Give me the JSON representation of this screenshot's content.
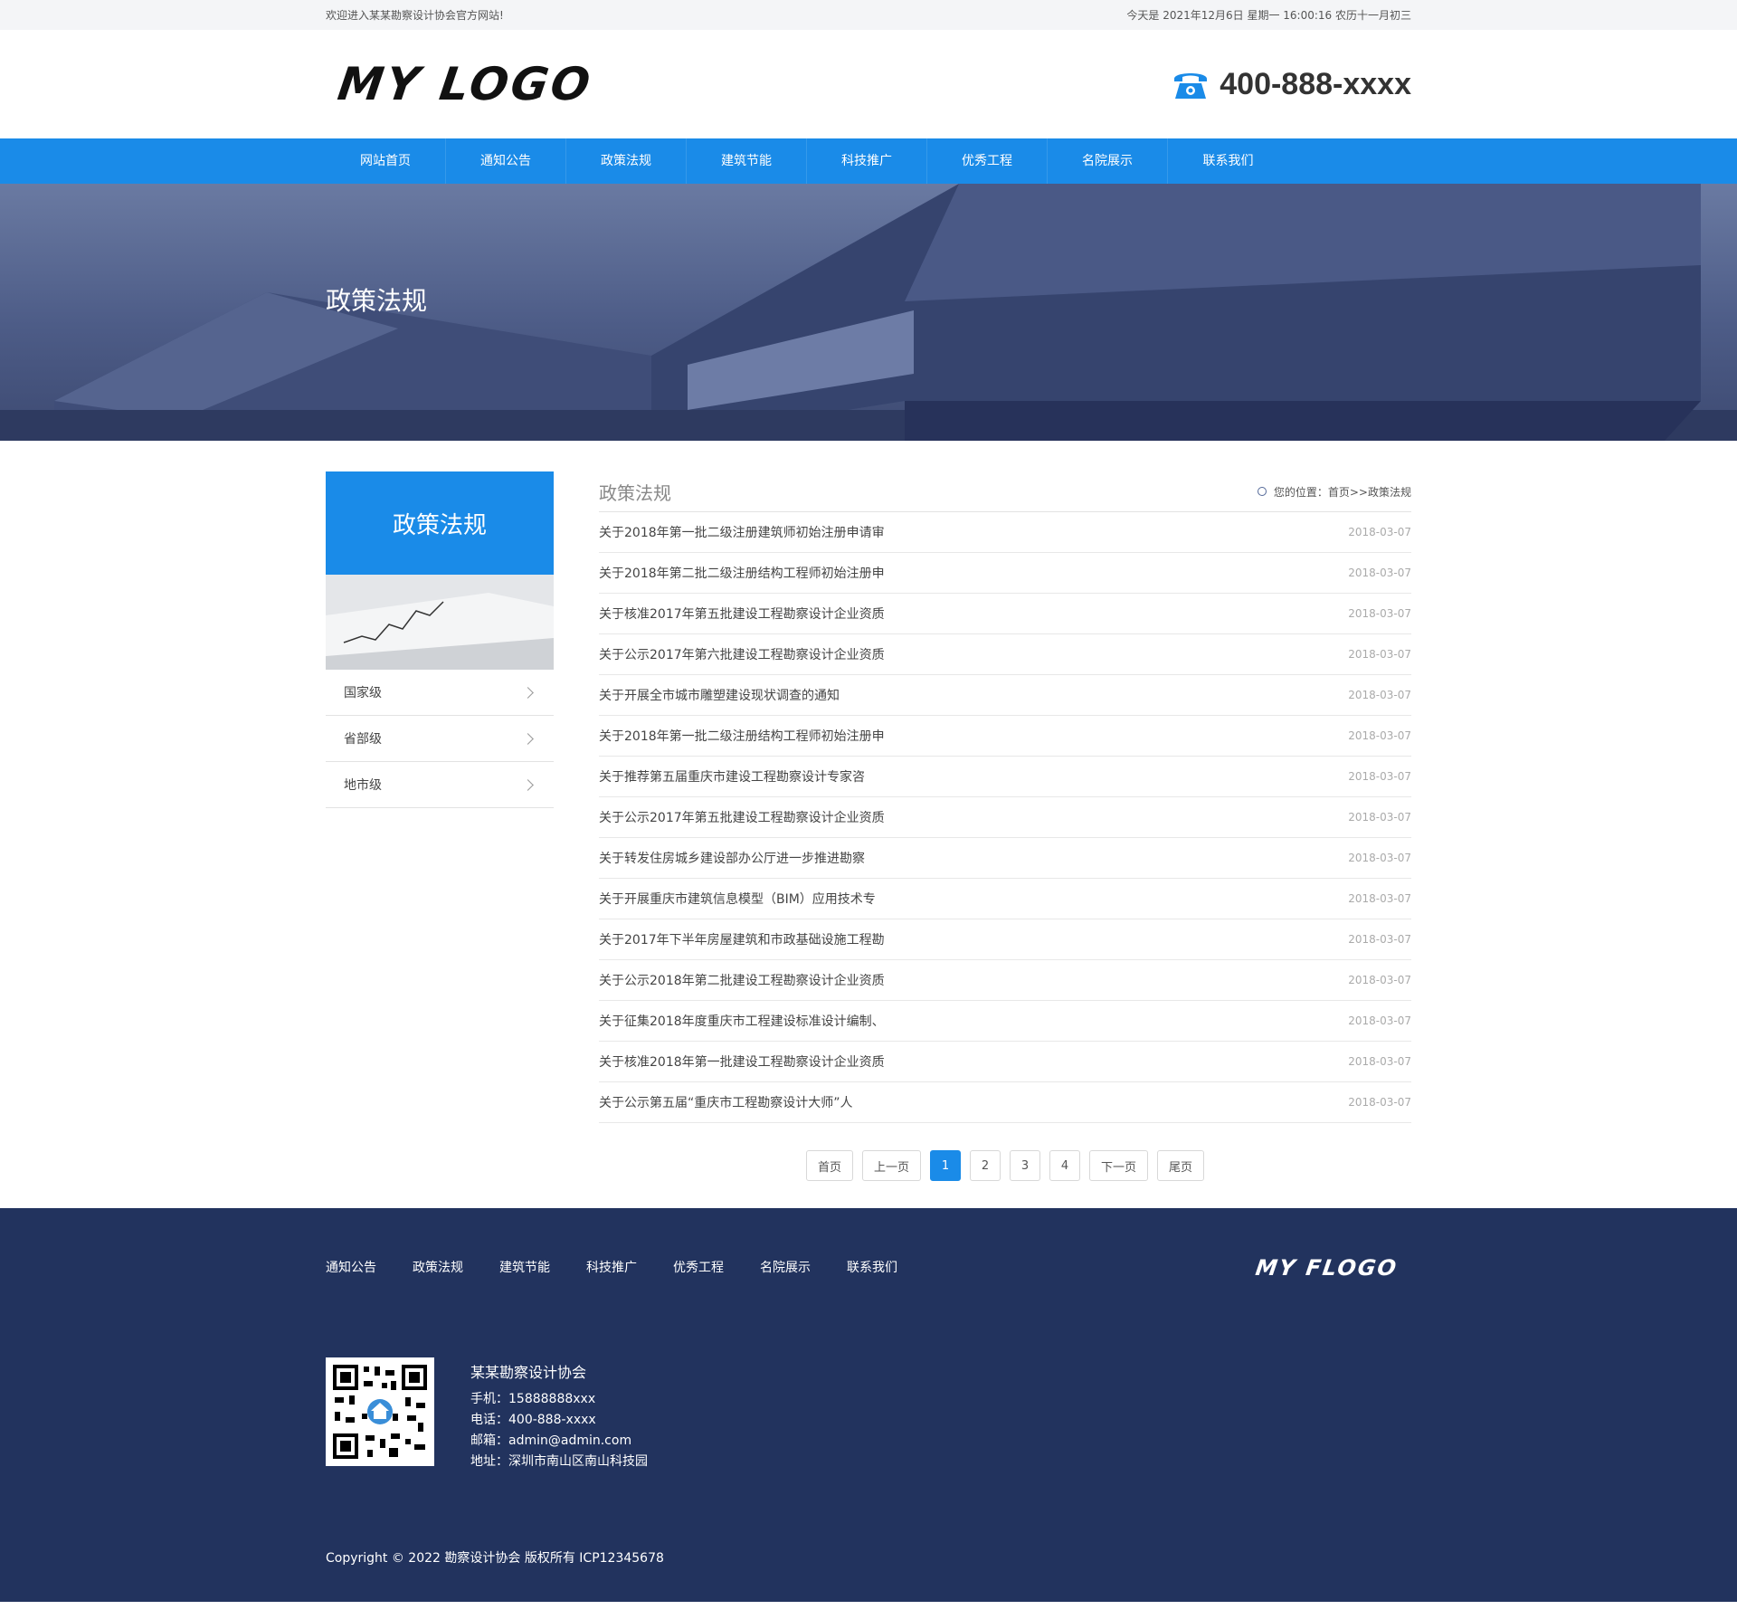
{
  "topbar": {
    "welcome": "欢迎进入某某勘察设计协会官方网站!",
    "datetime": "今天是 2021年12月6日 星期一 16:00:16 农历十一月初三"
  },
  "header": {
    "logo": "MY LOGO",
    "phone": "400-888-xxxx"
  },
  "nav": {
    "items": [
      "网站首页",
      "通知公告",
      "政策法规",
      "建筑节能",
      "科技推广",
      "优秀工程",
      "名院展示",
      "联系我们"
    ]
  },
  "banner": {
    "title": "政策法规"
  },
  "sidebar": {
    "title": "政策法规",
    "items": [
      "国家级",
      "省部级",
      "地市级"
    ]
  },
  "content": {
    "title": "政策法规",
    "breadcrumb": "您的位置：首页>>政策法规",
    "news": [
      {
        "title": "关于2018年第一批二级注册建筑师初始注册申请审",
        "date": "2018-03-07"
      },
      {
        "title": "关于2018年第二批二级注册结构工程师初始注册申",
        "date": "2018-03-07"
      },
      {
        "title": "关于核准2017年第五批建设工程勘察设计企业资质",
        "date": "2018-03-07"
      },
      {
        "title": "关于公示2017年第六批建设工程勘察设计企业资质",
        "date": "2018-03-07"
      },
      {
        "title": "关于开展全市城市雕塑建设现状调查的通知",
        "date": "2018-03-07"
      },
      {
        "title": "关于2018年第一批二级注册结构工程师初始注册申",
        "date": "2018-03-07"
      },
      {
        "title": "关于推荐第五届重庆市建设工程勘察设计专家咨",
        "date": "2018-03-07"
      },
      {
        "title": "关于公示2017年第五批建设工程勘察设计企业资质",
        "date": "2018-03-07"
      },
      {
        "title": "关于转发住房城乡建设部办公厅进一步推进勘察",
        "date": "2018-03-07"
      },
      {
        "title": "关于开展重庆市建筑信息模型（BIM）应用技术专",
        "date": "2018-03-07"
      },
      {
        "title": "关于2017年下半年房屋建筑和市政基础设施工程勘",
        "date": "2018-03-07"
      },
      {
        "title": "关于公示2018年第二批建设工程勘察设计企业资质",
        "date": "2018-03-07"
      },
      {
        "title": "关于征集2018年度重庆市工程建设标准设计编制、",
        "date": "2018-03-07"
      },
      {
        "title": "关于核准2018年第一批建设工程勘察设计企业资质",
        "date": "2018-03-07"
      },
      {
        "title": "关于公示第五届“重庆市工程勘察设计大师”人",
        "date": "2018-03-07"
      }
    ]
  },
  "pager": {
    "first": "首页",
    "prev": "上一页",
    "pages": [
      "1",
      "2",
      "3",
      "4"
    ],
    "next": "下一页",
    "last": "尾页"
  },
  "footer": {
    "nav": [
      "通知公告",
      "政策法规",
      "建筑节能",
      "科技推广",
      "优秀工程",
      "名院展示",
      "联系我们"
    ],
    "logo": "MY FLOGO",
    "org": "某某勘察设计协会",
    "mobile": "手机：15888888xxx",
    "tel": "电话：400-888-xxxx",
    "email": "邮箱：admin@admin.com",
    "address": "地址：深圳市南山区南山科技园",
    "copyright": "Copyright © 2022 勘察设计协会 版权所有  ICP12345678"
  },
  "colors": {
    "primary": "#1a8be8",
    "footer_bg": "#22335e",
    "banner": "#4d5c87"
  }
}
